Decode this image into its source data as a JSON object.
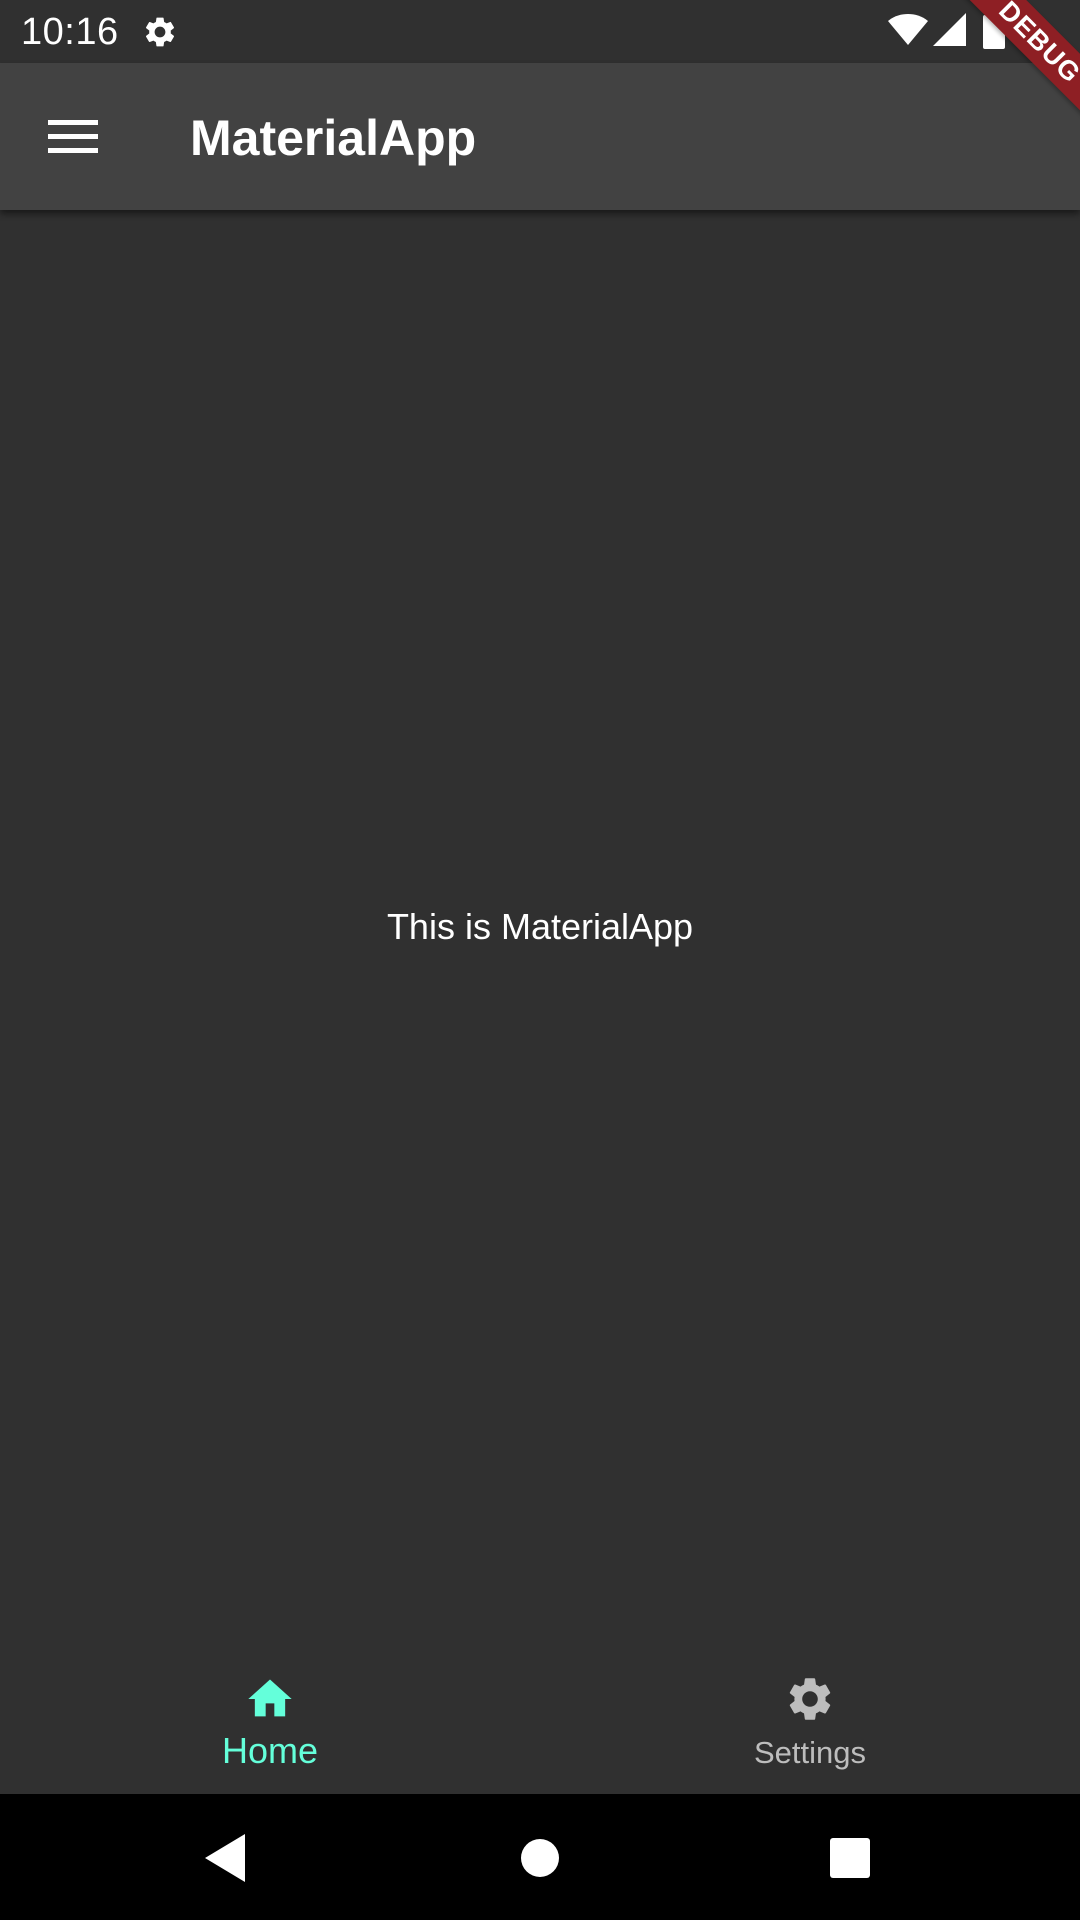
{
  "status_bar": {
    "time": "10:16",
    "icons": [
      "gear-icon",
      "wifi-icon",
      "signal-icon",
      "battery-icon"
    ]
  },
  "debug_banner": {
    "label": "DEBUG",
    "color": "#8e1f24"
  },
  "app_bar": {
    "menu_icon": "menu-icon",
    "title": "MaterialApp",
    "background": "#424242"
  },
  "body": {
    "text": "This is MaterialApp",
    "background": "#303030"
  },
  "bottom_nav": {
    "accent_color": "#64ffda",
    "items": [
      {
        "icon": "home-icon",
        "label": "Home",
        "selected": true
      },
      {
        "icon": "settings-icon",
        "label": "Settings",
        "selected": false
      }
    ]
  },
  "system_nav": {
    "buttons": [
      "back-icon",
      "home-circle-icon",
      "recents-icon"
    ]
  }
}
